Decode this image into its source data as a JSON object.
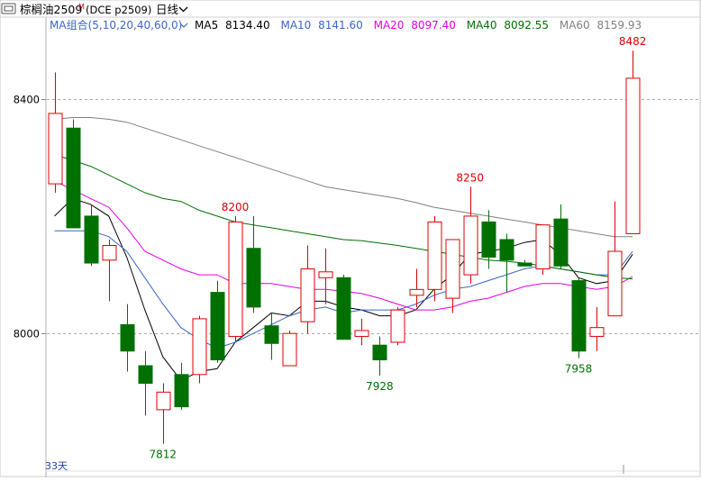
{
  "header": {
    "instrument": "棕榈油2509",
    "main_flag": "M",
    "exchange_code": "(DCE p2509)",
    "period": "日线",
    "chevron": "chevron-down-icon",
    "ma_set": "MA组合(5,10,20,40,60,0)",
    "ma_items": [
      {
        "label": "MA5",
        "value": "8134.40",
        "color": "#000000"
      },
      {
        "label": "MA10",
        "value": "8141.60",
        "color": "#3a66c4"
      },
      {
        "label": "MA20",
        "value": "8097.40",
        "color": "#e000e0"
      },
      {
        "label": "MA40",
        "value": "8092.55",
        "color": "#007000"
      },
      {
        "label": "MA60",
        "value": "8159.93",
        "color": "#808080"
      }
    ]
  },
  "footer": {
    "days_label": "33天"
  },
  "chart_data": {
    "type": "candlestick",
    "ylim": [
      7770,
      8510
    ],
    "yticks": [
      8000,
      8400
    ],
    "up_color": "#dd0000",
    "down_color": "#007000",
    "candles": [
      {
        "o": 8255,
        "h": 8445,
        "l": 8240,
        "c": 8375
      },
      {
        "o": 8350,
        "h": 8365,
        "l": 8180,
        "c": 8180
      },
      {
        "o": 8200,
        "h": 8220,
        "l": 8115,
        "c": 8120
      },
      {
        "o": 8125,
        "h": 8160,
        "l": 8055,
        "c": 8150
      },
      {
        "o": 8015,
        "h": 8050,
        "l": 7935,
        "c": 7970
      },
      {
        "o": 7945,
        "h": 7970,
        "l": 7860,
        "c": 7915
      },
      {
        "o": 7870,
        "h": 7915,
        "l": 7812,
        "c": 7900
      },
      {
        "o": 7930,
        "h": 7950,
        "l": 7870,
        "c": 7875
      },
      {
        "o": 7930,
        "h": 8030,
        "l": 7915,
        "c": 8025
      },
      {
        "o": 8070,
        "h": 8090,
        "l": 7950,
        "c": 7955
      },
      {
        "o": 7995,
        "h": 8200,
        "l": 7985,
        "c": 8190
      },
      {
        "o": 8145,
        "h": 8200,
        "l": 8035,
        "c": 8045
      },
      {
        "o": 8013,
        "h": 8035,
        "l": 7955,
        "c": 7983
      },
      {
        "o": 7945,
        "h": 8005,
        "l": 7945,
        "c": 8000
      },
      {
        "o": 8020,
        "h": 8150,
        "l": 8000,
        "c": 8110
      },
      {
        "o": 8095,
        "h": 8145,
        "l": 8050,
        "c": 8105
      },
      {
        "o": 8095,
        "h": 8100,
        "l": 7995,
        "c": 7990
      },
      {
        "o": 7995,
        "h": 8025,
        "l": 7980,
        "c": 8005
      },
      {
        "o": 7980,
        "h": 7995,
        "l": 7928,
        "c": 7955
      },
      {
        "o": 7985,
        "h": 8045,
        "l": 7980,
        "c": 8040
      },
      {
        "o": 8065,
        "h": 8110,
        "l": 8045,
        "c": 8075
      },
      {
        "o": 8075,
        "h": 8200,
        "l": 8055,
        "c": 8190
      },
      {
        "o": 8060,
        "h": 8160,
        "l": 8035,
        "c": 8160
      },
      {
        "o": 8100,
        "h": 8250,
        "l": 8085,
        "c": 8200
      },
      {
        "o": 8190,
        "h": 8210,
        "l": 8110,
        "c": 8130
      },
      {
        "o": 8160,
        "h": 8170,
        "l": 8070,
        "c": 8125
      },
      {
        "o": 8120,
        "h": 8125,
        "l": 8115,
        "c": 8115
      },
      {
        "o": 8110,
        "h": 8185,
        "l": 8100,
        "c": 8185
      },
      {
        "o": 8195,
        "h": 8220,
        "l": 8110,
        "c": 8115
      },
      {
        "o": 8090,
        "h": 8095,
        "l": 7958,
        "c": 7970
      },
      {
        "o": 7995,
        "h": 8045,
        "l": 7970,
        "c": 8010
      },
      {
        "o": 8030,
        "h": 8225,
        "l": 8030,
        "c": 8140
      },
      {
        "o": 8170,
        "h": 8482,
        "l": 8170,
        "c": 8435
      }
    ],
    "annotations": [
      {
        "label": "8482",
        "index": 32,
        "value": 8482,
        "color": "#dd0000",
        "pos": "above"
      },
      {
        "label": "8250",
        "index": 23,
        "value": 8250,
        "color": "#dd0000",
        "pos": "above"
      },
      {
        "label": "8200",
        "index": 10,
        "value": 8200,
        "color": "#dd0000",
        "pos": "above"
      },
      {
        "label": "7812",
        "index": 6,
        "value": 7812,
        "color": "#007000",
        "pos": "below"
      },
      {
        "label": "7928",
        "index": 18,
        "value": 7928,
        "color": "#007000",
        "pos": "below"
      },
      {
        "label": "7958",
        "index": 29,
        "value": 7958,
        "color": "#007000",
        "pos": "below"
      }
    ],
    "ma_lines": [
      {
        "name": "MA5",
        "color": "#000000",
        "values": [
          8200,
          8230,
          8220,
          8200,
          8130,
          8040,
          7960,
          7920,
          7935,
          7940,
          7985,
          8010,
          8035,
          8030,
          8055,
          8055,
          8045,
          8040,
          8030,
          8030,
          8040,
          8075,
          8100,
          8135,
          8140,
          8145,
          8155,
          8160,
          8135,
          8095,
          8085,
          8090,
          8135
        ]
      },
      {
        "name": "MA10",
        "color": "#3a66c4",
        "values": [
          8175,
          8175,
          8175,
          8165,
          8140,
          8095,
          8050,
          8010,
          7990,
          7975,
          7985,
          8000,
          8015,
          8030,
          8040,
          8045,
          8035,
          8040,
          8040,
          8040,
          8050,
          8065,
          8075,
          8080,
          8090,
          8100,
          8110,
          8115,
          8110,
          8105,
          8100,
          8100,
          8140
        ]
      },
      {
        "name": "MA20",
        "color": "#e000e0",
        "values": [
          8260,
          8245,
          8230,
          8215,
          8180,
          8140,
          8125,
          8110,
          8100,
          8100,
          8085,
          8085,
          8085,
          8080,
          8075,
          8075,
          8072,
          8068,
          8060,
          8050,
          8040,
          8040,
          8045,
          8055,
          8060,
          8070,
          8080,
          8085,
          8085,
          8080,
          8075,
          8080,
          8097
        ]
      },
      {
        "name": "MA40",
        "color": "#007000",
        "values": [
          8305,
          8295,
          8285,
          8270,
          8255,
          8240,
          8230,
          8225,
          8210,
          8200,
          8190,
          8185,
          8180,
          8175,
          8170,
          8165,
          8160,
          8158,
          8154,
          8150,
          8145,
          8140,
          8135,
          8130,
          8125,
          8123,
          8120,
          8115,
          8110,
          8105,
          8100,
          8095,
          8093
        ]
      },
      {
        "name": "MA60",
        "color": "#808080",
        "values": [
          8365,
          8368,
          8368,
          8365,
          8360,
          8350,
          8340,
          8330,
          8320,
          8310,
          8300,
          8290,
          8280,
          8270,
          8260,
          8250,
          8245,
          8240,
          8235,
          8230,
          8223,
          8215,
          8210,
          8205,
          8200,
          8195,
          8190,
          8185,
          8180,
          8175,
          8170,
          8165,
          8165
        ]
      }
    ]
  }
}
